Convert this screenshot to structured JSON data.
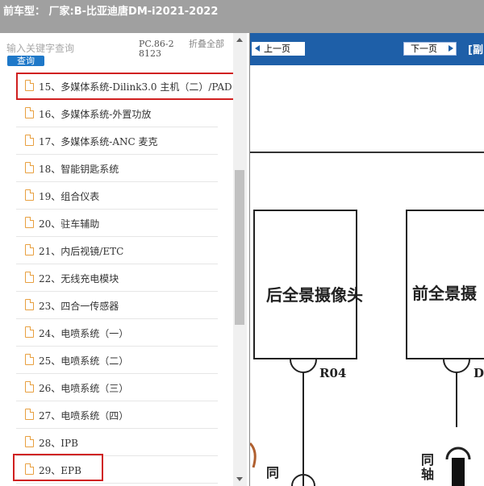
{
  "window": {
    "title": "前车型： 厂家:B-比亚迪唐DM-i2021-2022"
  },
  "sidebar": {
    "search_placeholder": "输入关键字查询",
    "search_button": "查询",
    "page_code": "PC.86-28123",
    "collapse_all": "折叠全部",
    "items": [
      {
        "label": "15、多媒体系统-Dilink3.0 主机（二）/PAD",
        "highlighted": true
      },
      {
        "label": "16、多媒体系统-外置功放"
      },
      {
        "label": "17、多媒体系统-ANC 麦克"
      },
      {
        "label": "18、智能钥匙系统"
      },
      {
        "label": "19、组合仪表"
      },
      {
        "label": "20、驻车辅助"
      },
      {
        "label": "21、内后视镜/ETC"
      },
      {
        "label": "22、无线充电模块"
      },
      {
        "label": "23、四合一传感器"
      },
      {
        "label": "24、电喷系统（一）"
      },
      {
        "label": "25、电喷系统（二）"
      },
      {
        "label": "26、电喷系统（三）"
      },
      {
        "label": "27、电喷系统（四）"
      },
      {
        "label": "28、IPB"
      },
      {
        "label": "29、EPB",
        "highlighted": true
      }
    ]
  },
  "viewer": {
    "prev_page": "上一页",
    "next_page": "下一页",
    "doc_title": "[副",
    "diagram": {
      "left_box_label": "后全景摄像头",
      "right_box_label": "前全景摄",
      "left_connector": "R04",
      "right_connector": "D",
      "left_vertical_text": "同",
      "right_vertical_text": "同轴"
    }
  },
  "colors": {
    "titlebar_bg": "#a0a0a0",
    "nav_bar_bg": "#1e5fa8",
    "search_button_bg": "#1e78c8",
    "highlight_border": "#d02020",
    "file_icon": "#e8a040"
  }
}
